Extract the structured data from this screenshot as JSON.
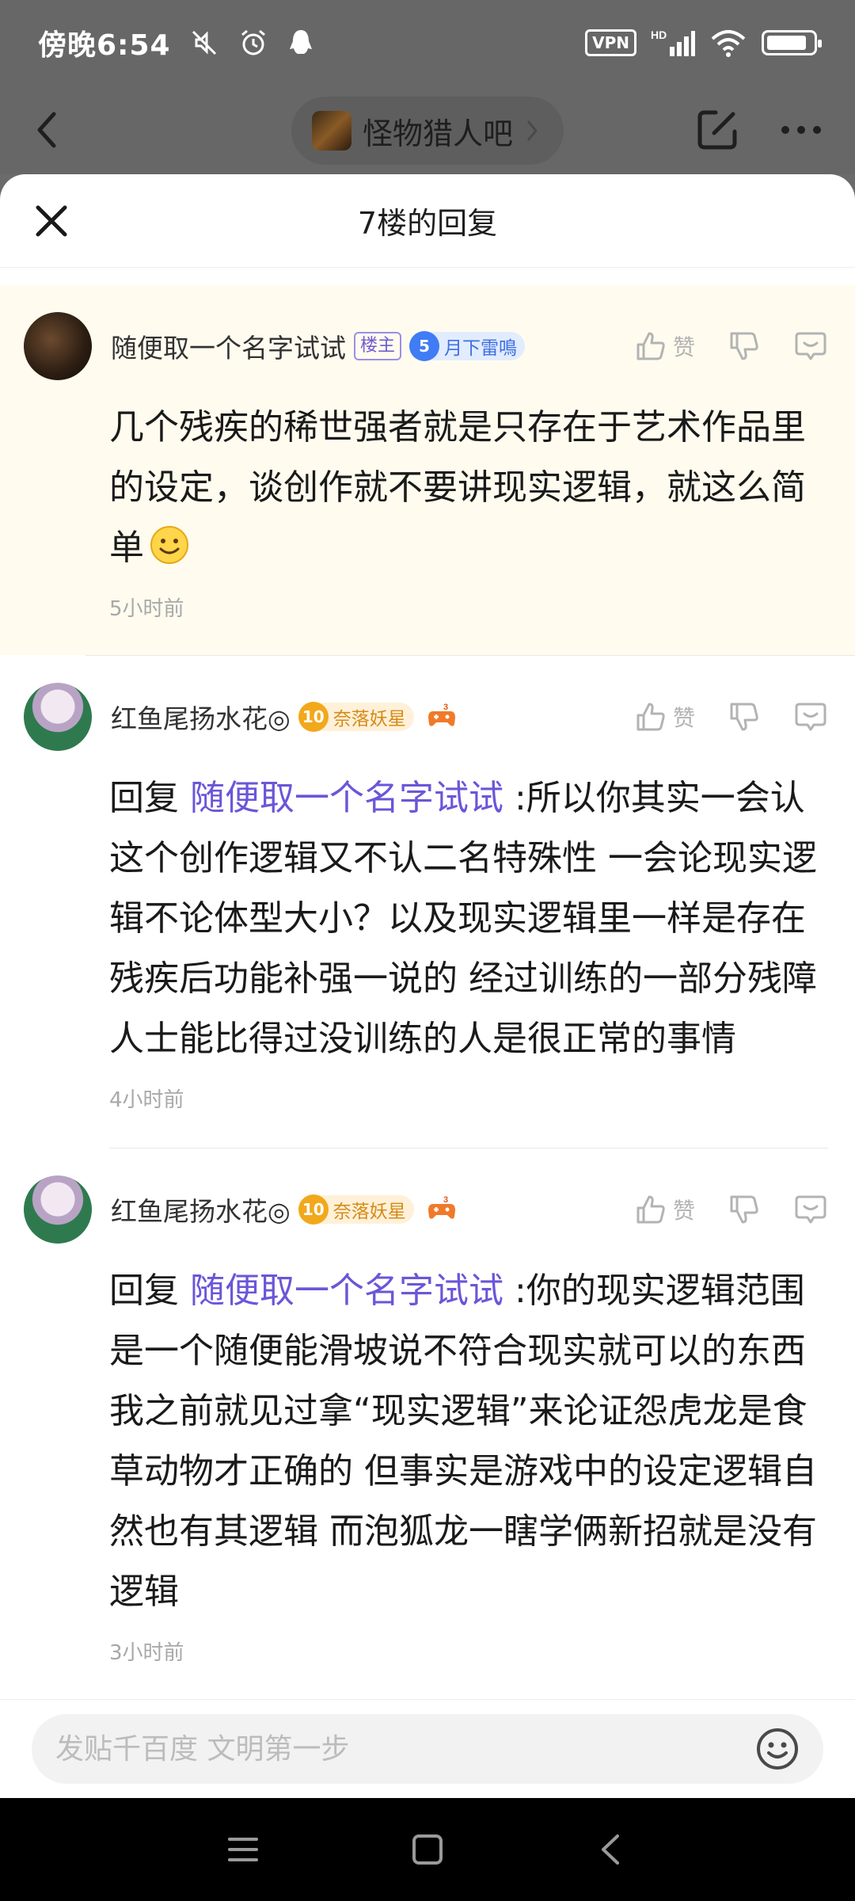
{
  "status_bar": {
    "time": "傍晚6:54",
    "vpn": "VPN",
    "network": "HD"
  },
  "top_bar": {
    "forum_name": "怪物猎人吧"
  },
  "sheet": {
    "title": "7楼的回复"
  },
  "replies": [
    {
      "username": "随便取一个名字试试",
      "tag": "楼主",
      "level": "5",
      "badge": "月下雷鳴",
      "like_label": "赞",
      "text": "几个残疾的稀世强者就是只存在于艺术作品里的设定，谈创作就不要讲现实逻辑，就这么简单",
      "time": "5小时前"
    },
    {
      "username": "红鱼尾扬水花◎",
      "level": "10",
      "badge": "奈落妖星",
      "like_label": "赞",
      "prefix": "回复",
      "mention": "随便取一个名字试试",
      "text": " :所以你其实一会认这个创作逻辑又不认二名特殊性 一会论现实逻辑不论体型大小？以及现实逻辑里一样是存在残疾后功能补强一说的 经过训练的一部分残障人士能比得过没训练的人是很正常的事情",
      "time": "4小时前"
    },
    {
      "username": "红鱼尾扬水花◎",
      "level": "10",
      "badge": "奈落妖星",
      "like_label": "赞",
      "prefix": "回复",
      "mention": "随便取一个名字试试",
      "text": " :你的现实逻辑范围是一个随便能滑坡说不符合现实就可以的东西 我之前就见过拿“现实逻辑”来论证怨虎龙是食草动物才正确的 但事实是游戏中的设定逻辑自然也有其逻辑 而泡狐龙一瞎学俩新招就是没有逻辑",
      "time": "3小时前"
    }
  ],
  "input": {
    "placeholder": "发贴千百度 文明第一步"
  },
  "colors": {
    "mention": "#6b56d8",
    "op_background": "#fffcef",
    "dim_overlay": "#676767"
  },
  "icons": [
    "back-arrow-icon",
    "edit-icon",
    "more-icon",
    "close-icon",
    "thumbs-up-icon",
    "thumbs-down-icon",
    "comment-icon",
    "smile-icon",
    "menu-icon",
    "home-square-icon",
    "nav-back-icon"
  ]
}
